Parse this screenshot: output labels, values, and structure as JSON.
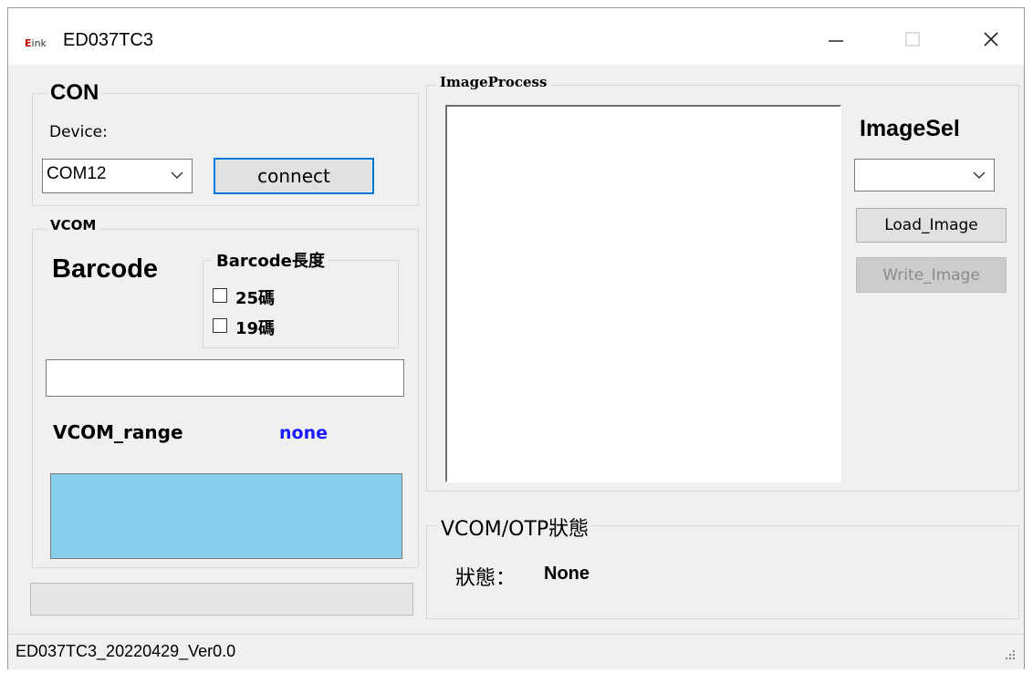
{
  "window": {
    "logo_e": "E",
    "logo_ink": "ink",
    "title": "ED037TC3",
    "minimize_glyph": "—",
    "maximize_glyph": "☐",
    "close_glyph": "✕"
  },
  "con": {
    "legend": "CON",
    "device_label": "Device:",
    "device_value": "COM12",
    "connect_label": "connect"
  },
  "vcom": {
    "legend": "VCOM",
    "barcode_title": "Barcode",
    "barcode_length_legend": "Barcode長度",
    "option_25": "25碼",
    "option_19": "19碼",
    "barcode_input": "",
    "range_label": "VCOM_range",
    "range_value": "none",
    "range_value_color": "#1a1aff",
    "status_panel_color": "#87ceeb"
  },
  "image_process": {
    "legend": "ImageProcess",
    "image_sel_title": "ImageSel",
    "image_sel_value": "",
    "load_image_label": "Load_Image",
    "write_image_label": "Write_Image"
  },
  "vcom_otp": {
    "legend": "VCOM/OTP狀態",
    "status_label": "狀態：",
    "status_value": "None"
  },
  "statusbar": {
    "version": "ED037TC3_20220429_Ver0.0"
  }
}
